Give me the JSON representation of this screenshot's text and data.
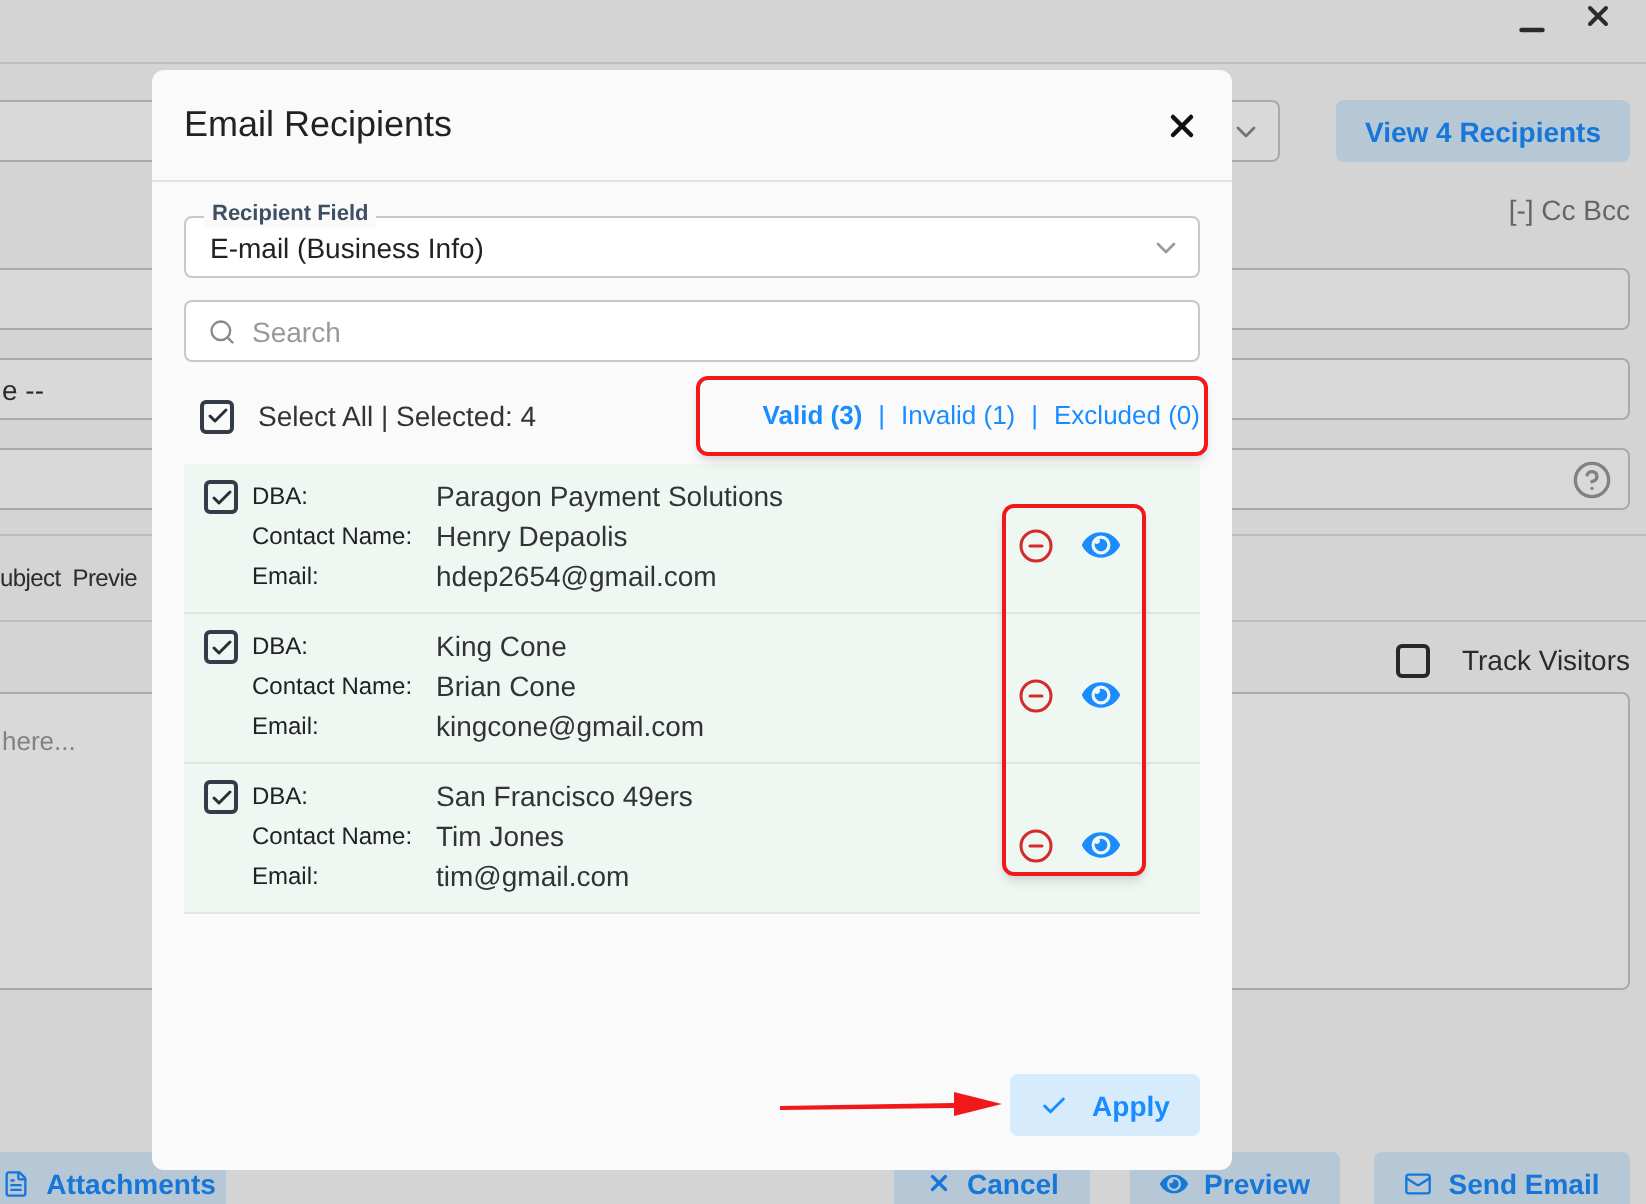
{
  "background_form": {
    "view_recipients_button": "View 4 Recipients",
    "cc_bcc": "[-] Cc Bcc",
    "field_text": "e --",
    "labels": [
      "ubject",
      "Previe"
    ],
    "track_visitors": {
      "label": "Track Visitors",
      "checked": false
    },
    "body_placeholder": "here...",
    "buttons": [
      {
        "label": "Attachments",
        "kind": "attach"
      },
      {
        "label": "Cancel",
        "kind": "cancel"
      },
      {
        "label": "Preview",
        "kind": "preview"
      },
      {
        "label": "Send Email",
        "kind": "send"
      }
    ]
  },
  "dialog": {
    "title": "Email Recipients",
    "recipient_field": {
      "label": "Recipient Field",
      "value": "E-mail (Business Info)"
    },
    "search": {
      "placeholder": "Search"
    },
    "select_all": {
      "label": "Select All | Selected: 4",
      "checked": true
    },
    "filters": [
      {
        "label": "Valid (3)",
        "selected": true
      },
      {
        "separator": "|",
        "label": "Invalid (1)",
        "selected": false
      },
      {
        "separator": "|",
        "label": "Excluded (0)",
        "selected": false
      }
    ],
    "recipients": [
      {
        "checked": true,
        "fields": [
          {
            "label": "DBA:",
            "value": "Paragon Payment Solutions"
          },
          {
            "label": "Contact Name:",
            "value": "Henry Depaolis"
          },
          {
            "label": "Email:",
            "value": "hdep2654@gmail.com"
          }
        ]
      },
      {
        "checked": true,
        "fields": [
          {
            "label": "DBA:",
            "value": "King Cone"
          },
          {
            "label": "Contact Name:",
            "value": "Brian Cone"
          },
          {
            "label": "Email:",
            "value": "kingcone@gmail.com"
          }
        ]
      },
      {
        "checked": true,
        "fields": [
          {
            "label": "DBA:",
            "value": "San Francisco 49ers"
          },
          {
            "label": "Contact Name:",
            "value": "Tim Jones"
          },
          {
            "label": "Email:",
            "value": "tim@gmail.com"
          }
        ]
      }
    ],
    "apply_button": "Apply"
  }
}
